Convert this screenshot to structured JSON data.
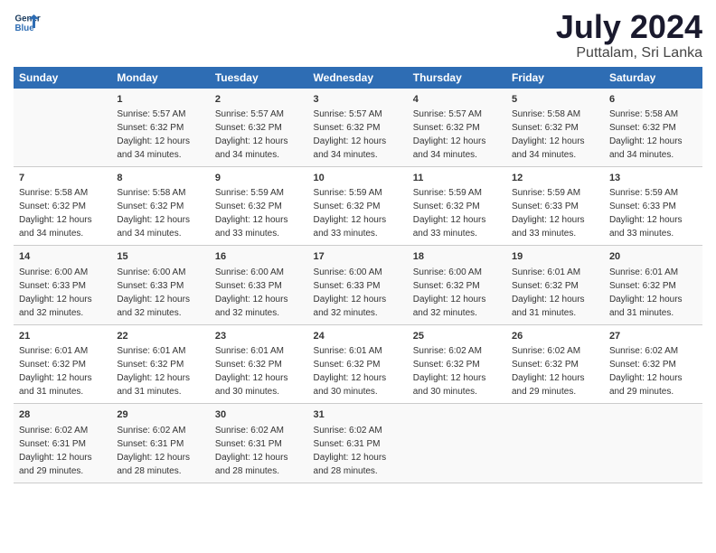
{
  "header": {
    "logo_line1": "General",
    "logo_line2": "Blue",
    "title": "July 2024",
    "subtitle": "Puttalam, Sri Lanka"
  },
  "weekdays": [
    "Sunday",
    "Monday",
    "Tuesday",
    "Wednesday",
    "Thursday",
    "Friday",
    "Saturday"
  ],
  "weeks": [
    [
      {
        "day": "",
        "info": ""
      },
      {
        "day": "1",
        "info": "Sunrise: 5:57 AM\nSunset: 6:32 PM\nDaylight: 12 hours\nand 34 minutes."
      },
      {
        "day": "2",
        "info": "Sunrise: 5:57 AM\nSunset: 6:32 PM\nDaylight: 12 hours\nand 34 minutes."
      },
      {
        "day": "3",
        "info": "Sunrise: 5:57 AM\nSunset: 6:32 PM\nDaylight: 12 hours\nand 34 minutes."
      },
      {
        "day": "4",
        "info": "Sunrise: 5:57 AM\nSunset: 6:32 PM\nDaylight: 12 hours\nand 34 minutes."
      },
      {
        "day": "5",
        "info": "Sunrise: 5:58 AM\nSunset: 6:32 PM\nDaylight: 12 hours\nand 34 minutes."
      },
      {
        "day": "6",
        "info": "Sunrise: 5:58 AM\nSunset: 6:32 PM\nDaylight: 12 hours\nand 34 minutes."
      }
    ],
    [
      {
        "day": "7",
        "info": "Sunrise: 5:58 AM\nSunset: 6:32 PM\nDaylight: 12 hours\nand 34 minutes."
      },
      {
        "day": "8",
        "info": "Sunrise: 5:58 AM\nSunset: 6:32 PM\nDaylight: 12 hours\nand 34 minutes."
      },
      {
        "day": "9",
        "info": "Sunrise: 5:59 AM\nSunset: 6:32 PM\nDaylight: 12 hours\nand 33 minutes."
      },
      {
        "day": "10",
        "info": "Sunrise: 5:59 AM\nSunset: 6:32 PM\nDaylight: 12 hours\nand 33 minutes."
      },
      {
        "day": "11",
        "info": "Sunrise: 5:59 AM\nSunset: 6:32 PM\nDaylight: 12 hours\nand 33 minutes."
      },
      {
        "day": "12",
        "info": "Sunrise: 5:59 AM\nSunset: 6:33 PM\nDaylight: 12 hours\nand 33 minutes."
      },
      {
        "day": "13",
        "info": "Sunrise: 5:59 AM\nSunset: 6:33 PM\nDaylight: 12 hours\nand 33 minutes."
      }
    ],
    [
      {
        "day": "14",
        "info": "Sunrise: 6:00 AM\nSunset: 6:33 PM\nDaylight: 12 hours\nand 32 minutes."
      },
      {
        "day": "15",
        "info": "Sunrise: 6:00 AM\nSunset: 6:33 PM\nDaylight: 12 hours\nand 32 minutes."
      },
      {
        "day": "16",
        "info": "Sunrise: 6:00 AM\nSunset: 6:33 PM\nDaylight: 12 hours\nand 32 minutes."
      },
      {
        "day": "17",
        "info": "Sunrise: 6:00 AM\nSunset: 6:33 PM\nDaylight: 12 hours\nand 32 minutes."
      },
      {
        "day": "18",
        "info": "Sunrise: 6:00 AM\nSunset: 6:32 PM\nDaylight: 12 hours\nand 32 minutes."
      },
      {
        "day": "19",
        "info": "Sunrise: 6:01 AM\nSunset: 6:32 PM\nDaylight: 12 hours\nand 31 minutes."
      },
      {
        "day": "20",
        "info": "Sunrise: 6:01 AM\nSunset: 6:32 PM\nDaylight: 12 hours\nand 31 minutes."
      }
    ],
    [
      {
        "day": "21",
        "info": "Sunrise: 6:01 AM\nSunset: 6:32 PM\nDaylight: 12 hours\nand 31 minutes."
      },
      {
        "day": "22",
        "info": "Sunrise: 6:01 AM\nSunset: 6:32 PM\nDaylight: 12 hours\nand 31 minutes."
      },
      {
        "day": "23",
        "info": "Sunrise: 6:01 AM\nSunset: 6:32 PM\nDaylight: 12 hours\nand 30 minutes."
      },
      {
        "day": "24",
        "info": "Sunrise: 6:01 AM\nSunset: 6:32 PM\nDaylight: 12 hours\nand 30 minutes."
      },
      {
        "day": "25",
        "info": "Sunrise: 6:02 AM\nSunset: 6:32 PM\nDaylight: 12 hours\nand 30 minutes."
      },
      {
        "day": "26",
        "info": "Sunrise: 6:02 AM\nSunset: 6:32 PM\nDaylight: 12 hours\nand 29 minutes."
      },
      {
        "day": "27",
        "info": "Sunrise: 6:02 AM\nSunset: 6:32 PM\nDaylight: 12 hours\nand 29 minutes."
      }
    ],
    [
      {
        "day": "28",
        "info": "Sunrise: 6:02 AM\nSunset: 6:31 PM\nDaylight: 12 hours\nand 29 minutes."
      },
      {
        "day": "29",
        "info": "Sunrise: 6:02 AM\nSunset: 6:31 PM\nDaylight: 12 hours\nand 28 minutes."
      },
      {
        "day": "30",
        "info": "Sunrise: 6:02 AM\nSunset: 6:31 PM\nDaylight: 12 hours\nand 28 minutes."
      },
      {
        "day": "31",
        "info": "Sunrise: 6:02 AM\nSunset: 6:31 PM\nDaylight: 12 hours\nand 28 minutes."
      },
      {
        "day": "",
        "info": ""
      },
      {
        "day": "",
        "info": ""
      },
      {
        "day": "",
        "info": ""
      }
    ]
  ]
}
